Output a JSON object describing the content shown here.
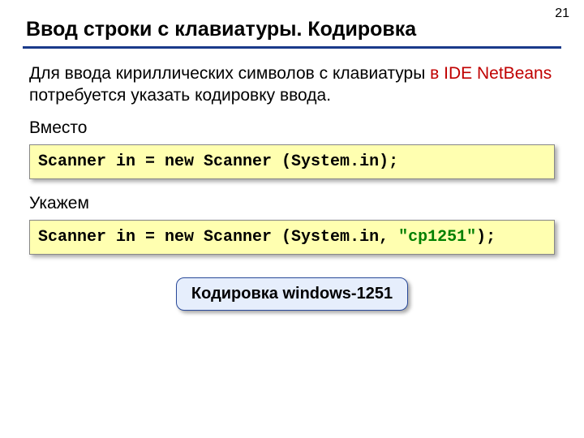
{
  "page_number": "21",
  "title": "Ввод строки с клавиатуры. Кодировка",
  "para_start": "Для ввода кириллических символов с клавиатуры ",
  "para_red": "в IDE NetBeans",
  "para_end": " потребуется указать кодировку ввода.",
  "label_instead": "Вместо",
  "code1": "Scanner in = new Scanner (System.in);",
  "label_use": "Укажем",
  "code2_a": "Scanner in = new Scanner (System.in, ",
  "code2_green": "\"cp1251\"",
  "code2_b": ");",
  "callout": "Кодировка windows-1251"
}
